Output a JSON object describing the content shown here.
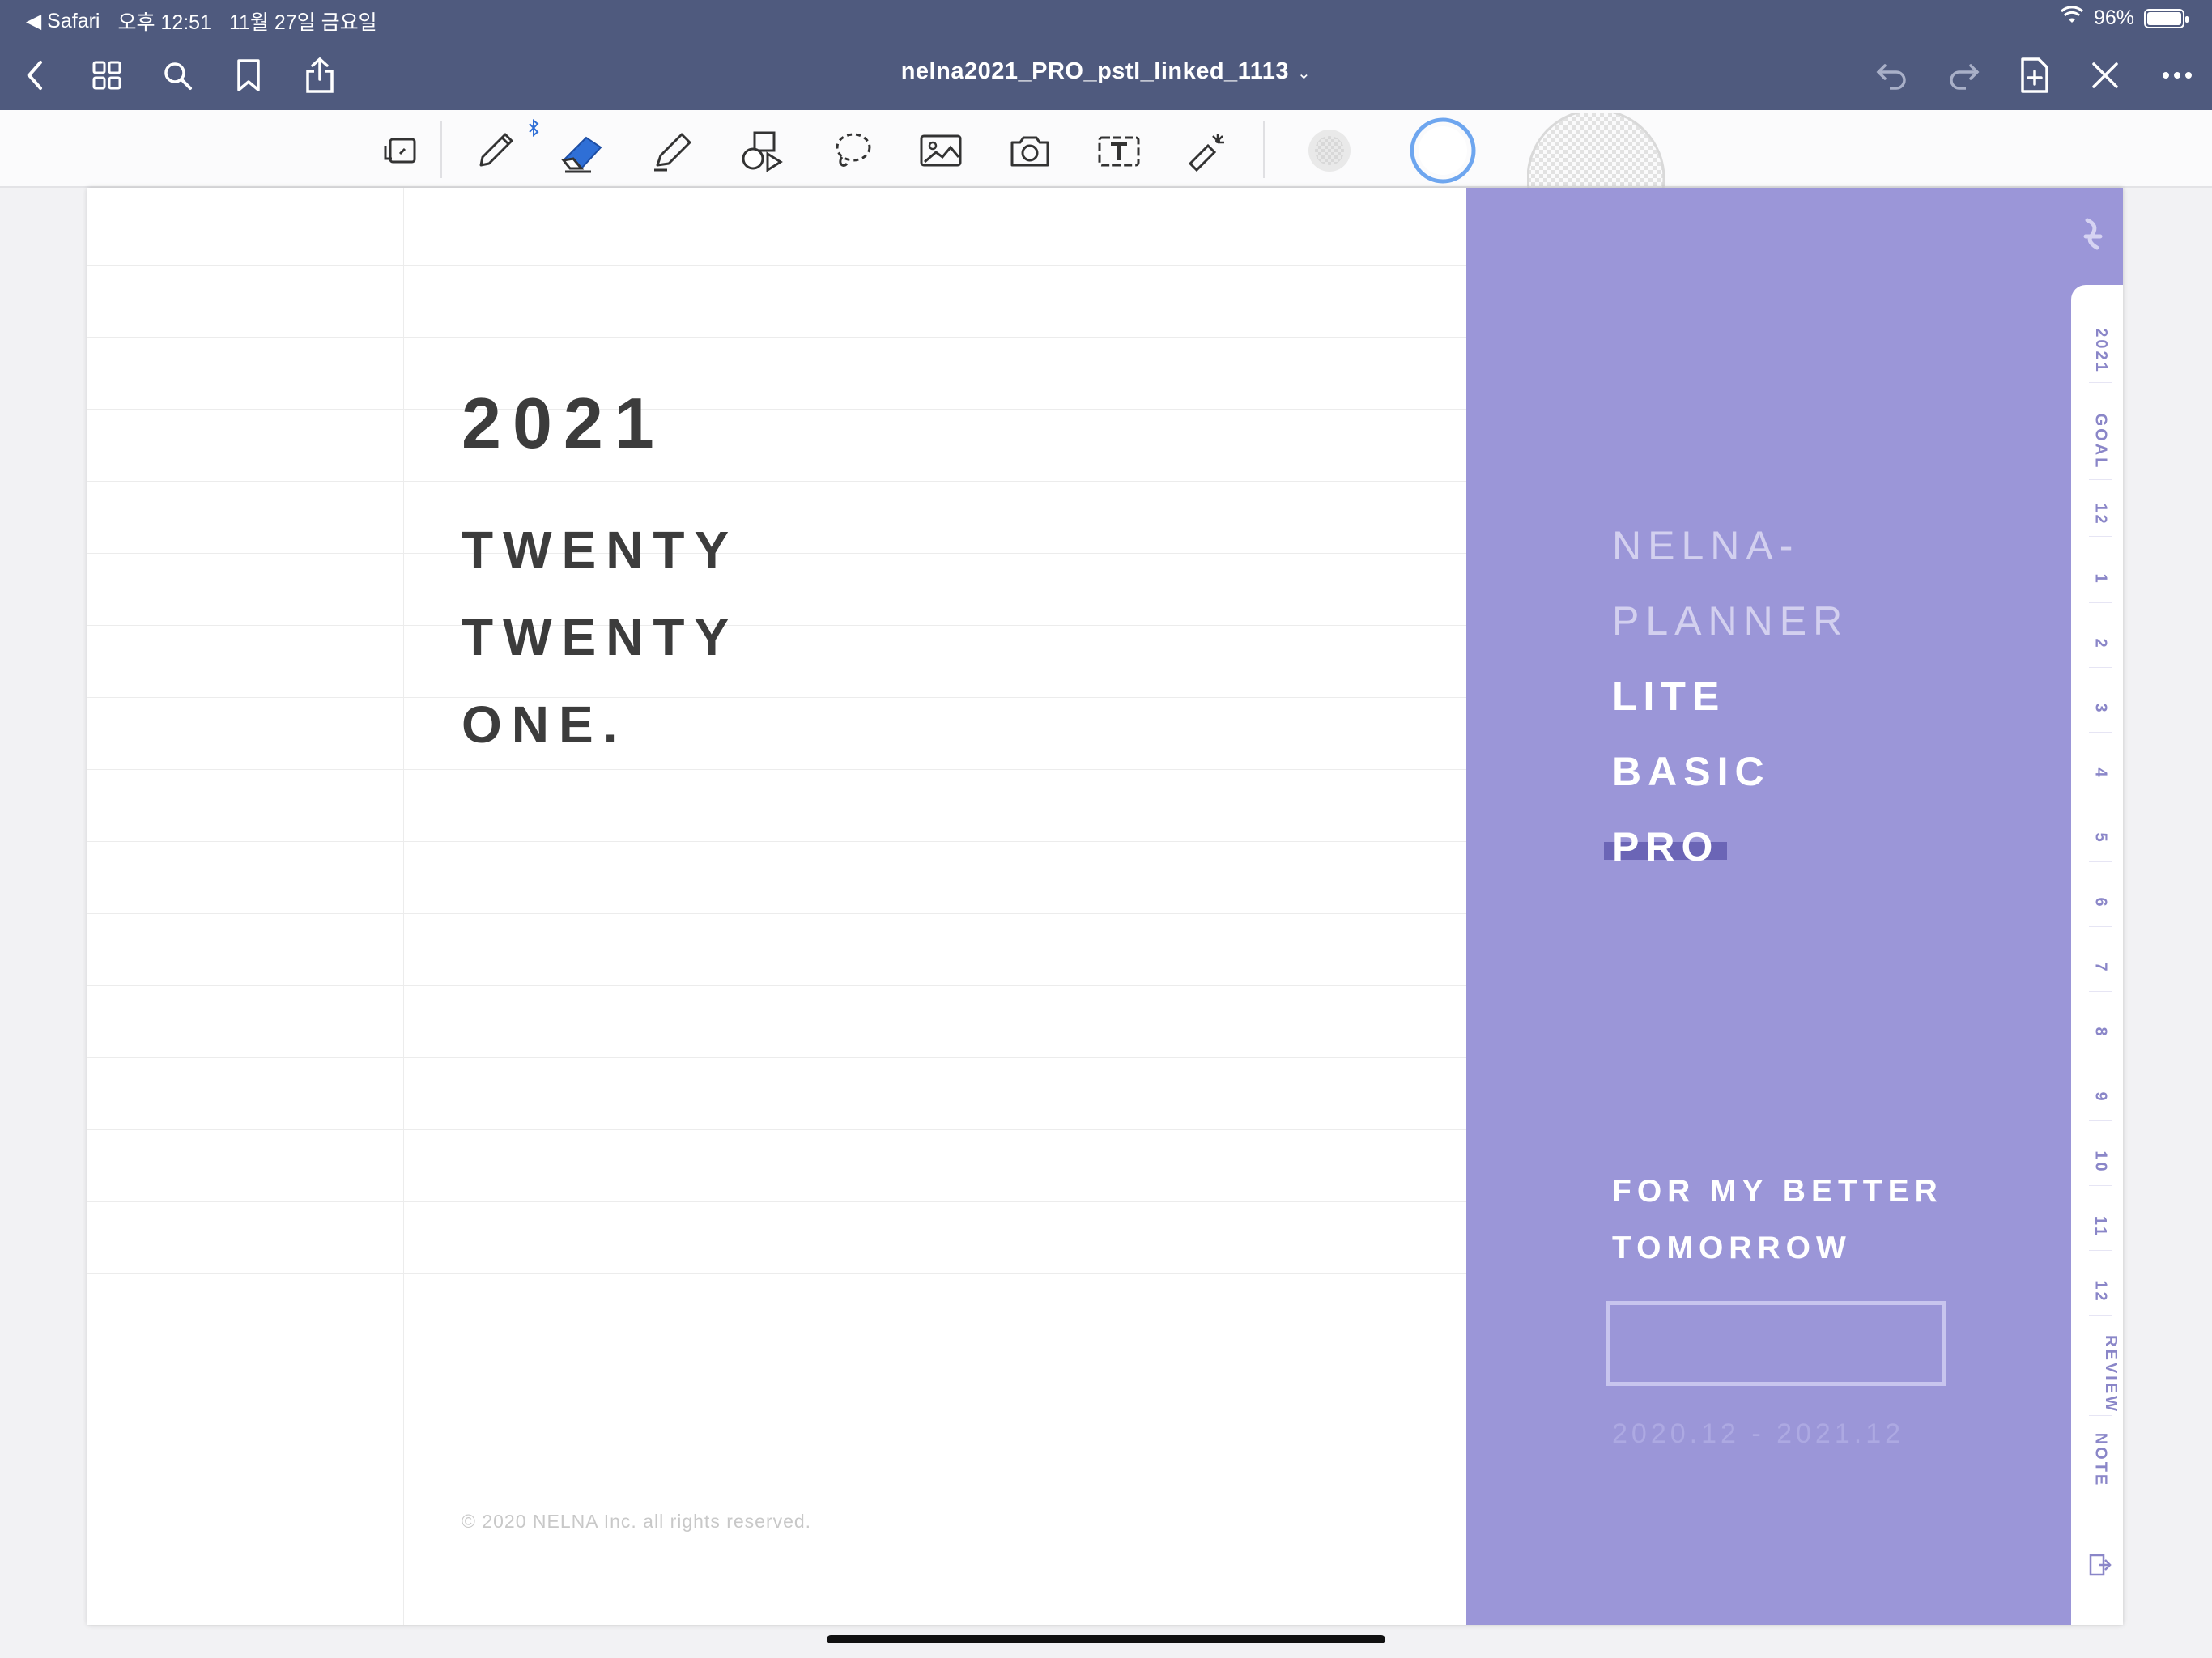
{
  "status_bar": {
    "back_app": "◀ Safari",
    "time": "오후 12:51",
    "date": "11월 27일 금요일",
    "battery": "96%",
    "battery_level": 0.96
  },
  "nav": {
    "title": "nelna2021_PRO_pstl_linked_1113",
    "title_chevron": "⌄"
  },
  "toolbar": {
    "tools": [
      "page-layout-icon",
      "pen-icon",
      "eraser-icon",
      "highlighter-icon",
      "shapes-icon",
      "lasso-icon",
      "image-icon",
      "camera-icon",
      "text-icon",
      "laser-pointer-icon"
    ],
    "active_tool": "eraser-icon",
    "accent": "#2f6fd6"
  },
  "page": {
    "year": "2021",
    "tagline": [
      "TWENTY",
      "TWENTY",
      "ONE."
    ],
    "copyright": "© 2020 NELNA Inc. all rights reserved."
  },
  "cover": {
    "brand_line1": "NELNA-",
    "brand_line2": "PLANNER",
    "editions": [
      "LITE",
      "BASIC",
      "PRO"
    ],
    "slogan_line1": "FOR MY BETTER",
    "slogan_line2": "TOMORROW",
    "date_range": "2020.12 - 2021.12",
    "color": "#9b96d8"
  },
  "tabs": [
    "2021",
    "GOAL",
    "12",
    "1",
    "2",
    "3",
    "4",
    "5",
    "6",
    "7",
    "8",
    "9",
    "10",
    "11",
    "12",
    "REVIEW",
    "NOTE"
  ]
}
